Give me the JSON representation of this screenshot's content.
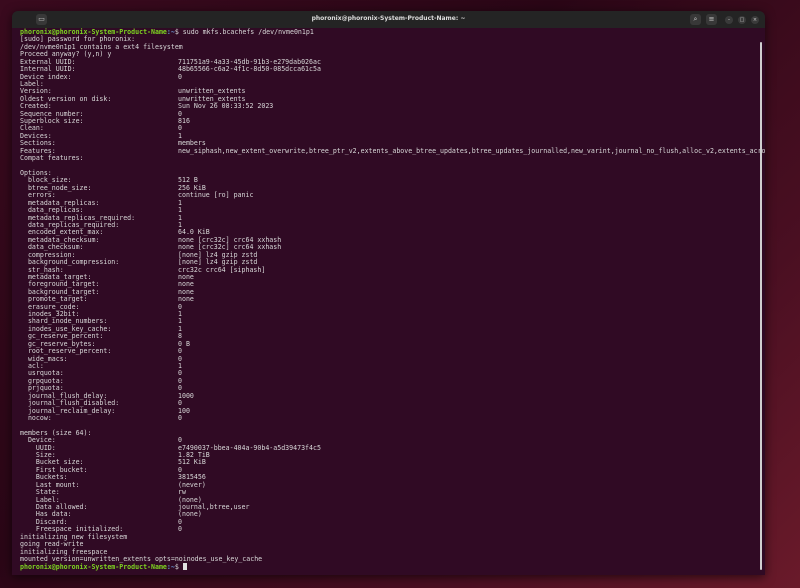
{
  "window": {
    "title": "phoronix@phoronix-System-Product-Name: ~",
    "icons": [
      "terminal-icon",
      "search-icon",
      "menu-icon",
      "minimize-icon",
      "maximize-icon",
      "close-icon"
    ]
  },
  "prompt": {
    "user": "phoronix@phoronix-System-Product-Name",
    "path": ":~",
    "symbol": "$ ",
    "command": "sudo mkfs.bcachefs /dev/nvme0n1p1"
  },
  "pre": [
    "[sudo] password for phoronix:",
    "/dev/nvme0n1p1 contains a ext4 filesystem",
    "Proceed anyway? (y,n) y"
  ],
  "superblock": [
    {
      "k": "External UUID:",
      "v": "711751a9-4a33-45db-91b3-e279dab026ac"
    },
    {
      "k": "Internal UUID:",
      "v": "48b65566-c6a2-4f1c-8d50-085dcca61c5a"
    },
    {
      "k": "Device index:",
      "v": "0"
    },
    {
      "k": "Label:",
      "v": ""
    },
    {
      "k": "Version:",
      "v": "unwritten_extents"
    },
    {
      "k": "Oldest version on disk:",
      "v": "unwritten_extents"
    },
    {
      "k": "Created:",
      "v": "Sun Nov 26 08:33:52 2023"
    },
    {
      "k": "Sequence number:",
      "v": "0"
    },
    {
      "k": "Superblock size:",
      "v": "816"
    },
    {
      "k": "Clean:",
      "v": "0"
    },
    {
      "k": "Devices:",
      "v": "1"
    },
    {
      "k": "Sections:",
      "v": "members"
    },
    {
      "k": "Features:",
      "v": "new_siphash,new_extent_overwrite,btree_ptr_v2,extents_above_btree_updates,btree_updates_journalled,new_varint,journal_no_flush,alloc_v2,extents_across_btree_nodes"
    },
    {
      "k": "Compat features:",
      "v": ""
    },
    {
      "k": "",
      "v": ""
    },
    {
      "k": "Options:",
      "v": ""
    }
  ],
  "options": [
    {
      "k": "  block_size:",
      "v": "512 B"
    },
    {
      "k": "  btree_node_size:",
      "v": "256 KiB"
    },
    {
      "k": "  errors:",
      "v": "continue [ro] panic"
    },
    {
      "k": "  metadata_replicas:",
      "v": "1"
    },
    {
      "k": "  data_replicas:",
      "v": "1"
    },
    {
      "k": "  metadata_replicas_required:",
      "v": "1"
    },
    {
      "k": "  data_replicas_required:",
      "v": "1"
    },
    {
      "k": "  encoded_extent_max:",
      "v": "64.0 KiB"
    },
    {
      "k": "  metadata_checksum:",
      "v": "none [crc32c] crc64 xxhash"
    },
    {
      "k": "  data_checksum:",
      "v": "none [crc32c] crc64 xxhash"
    },
    {
      "k": "  compression:",
      "v": "[none] lz4 gzip zstd"
    },
    {
      "k": "  background_compression:",
      "v": "[none] lz4 gzip zstd"
    },
    {
      "k": "  str_hash:",
      "v": "crc32c crc64 [siphash]"
    },
    {
      "k": "  metadata_target:",
      "v": "none"
    },
    {
      "k": "  foreground_target:",
      "v": "none"
    },
    {
      "k": "  background_target:",
      "v": "none"
    },
    {
      "k": "  promote_target:",
      "v": "none"
    },
    {
      "k": "  erasure_code:",
      "v": "0"
    },
    {
      "k": "  inodes_32bit:",
      "v": "1"
    },
    {
      "k": "  shard_inode_numbers:",
      "v": "1"
    },
    {
      "k": "  inodes_use_key_cache:",
      "v": "1"
    },
    {
      "k": "  gc_reserve_percent:",
      "v": "8"
    },
    {
      "k": "  gc_reserve_bytes:",
      "v": "0 B"
    },
    {
      "k": "  root_reserve_percent:",
      "v": "0"
    },
    {
      "k": "  wide_macs:",
      "v": "0"
    },
    {
      "k": "  acl:",
      "v": "1"
    },
    {
      "k": "  usrquota:",
      "v": "0"
    },
    {
      "k": "  grpquota:",
      "v": "0"
    },
    {
      "k": "  prjquota:",
      "v": "0"
    },
    {
      "k": "  journal_flush_delay:",
      "v": "1000"
    },
    {
      "k": "  journal_flush_disabled:",
      "v": "0"
    },
    {
      "k": "  journal_reclaim_delay:",
      "v": "100"
    },
    {
      "k": "  nocow:",
      "v": "0"
    },
    {
      "k": "",
      "v": ""
    },
    {
      "k": "members (size 64):",
      "v": ""
    }
  ],
  "members": [
    {
      "k": "  Device:",
      "v": "0"
    },
    {
      "k": "    UUID:",
      "v": "e7490037-bbea-404a-90b4-a5d39473f4c5"
    },
    {
      "k": "    Size:",
      "v": "1.82 TiB"
    },
    {
      "k": "    Bucket size:",
      "v": "512 KiB"
    },
    {
      "k": "    First bucket:",
      "v": "0"
    },
    {
      "k": "    Buckets:",
      "v": "3815456"
    },
    {
      "k": "    Last mount:",
      "v": "(never)"
    },
    {
      "k": "    State:",
      "v": "rw"
    },
    {
      "k": "    Label:",
      "v": "(none)"
    },
    {
      "k": "    Data allowed:",
      "v": "journal,btree,user"
    },
    {
      "k": "    Has data:",
      "v": "(none)"
    },
    {
      "k": "    Discard:",
      "v": "0"
    },
    {
      "k": "    Freespace initialized:",
      "v": "0"
    }
  ],
  "post": [
    "initializing new filesystem",
    "going read-write",
    "initializing freespace",
    "mounted version=unwritten_extents opts=noinodes_use_key_cache"
  ]
}
